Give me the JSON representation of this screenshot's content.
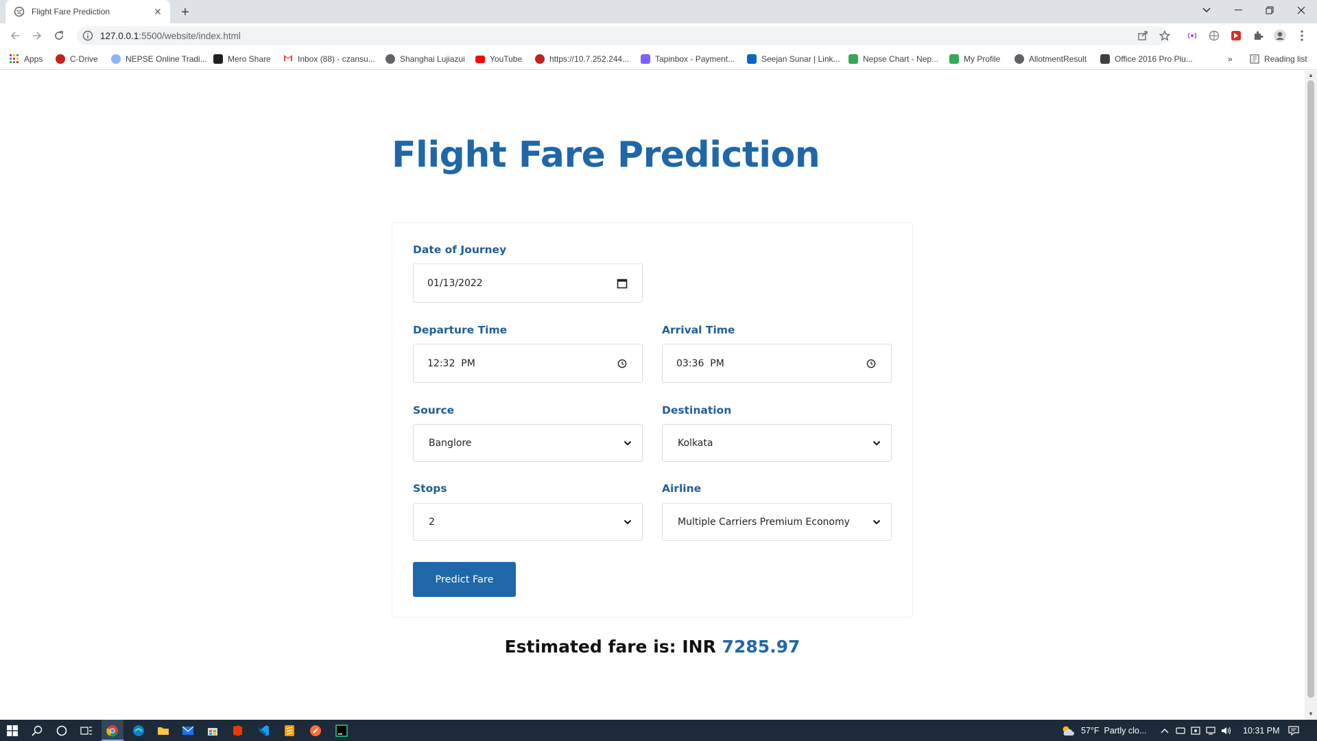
{
  "browser": {
    "tab_title": "Flight Fare Prediction",
    "url_host": "127.0.0.1",
    "url_path": ":5500/website/index.html",
    "bookmarks": [
      {
        "label": "Apps",
        "color": "#d93025"
      },
      {
        "label": "C-Drive",
        "color": "#c5221f"
      },
      {
        "label": "NEPSE Online Tradi...",
        "color": "#8ab4f8"
      },
      {
        "label": "Mero Share",
        "color": "#202124"
      },
      {
        "label": "Inbox (88) - czansu...",
        "color": "#ea4335"
      },
      {
        "label": "Shanghai Lujiazui",
        "color": "#5f6368"
      },
      {
        "label": "YouTube",
        "color": "#ff0000"
      },
      {
        "label": "https://10.7.252.244...",
        "color": "#c5221f"
      },
      {
        "label": "Tapinbox - Payment...",
        "color": "#7b61ff"
      },
      {
        "label": "Seejan Sunar | Link...",
        "color": "#0a66c2"
      },
      {
        "label": "Nepse Chart - Nep...",
        "color": "#34a853"
      },
      {
        "label": "My Profile",
        "color": "#34a853"
      },
      {
        "label": "AllotmentResult",
        "color": "#5f6368"
      },
      {
        "label": "Office 2016 Pro Plu...",
        "color": "#3c4043"
      }
    ],
    "reading_list": "Reading list"
  },
  "page": {
    "title": "Flight Fare Prediction",
    "form": {
      "date_label": "Date of Journey",
      "date_value": "01/13/2022",
      "departure_label": "Departure Time",
      "departure_value": "12:32  PM",
      "arrival_label": "Arrival Time",
      "arrival_value": "03:36  PM",
      "source_label": "Source",
      "source_value": "Banglore",
      "destination_label": "Destination",
      "destination_value": "Kolkata",
      "stops_label": "Stops",
      "stops_value": "2",
      "airline_label": "Airline",
      "airline_value": "Multiple Carriers Premium Economy",
      "submit_label": "Predict Fare"
    },
    "result_prefix": "Estimated fare is: INR ",
    "result_amount": "7285.97"
  },
  "taskbar": {
    "weather": "57°F  Partly clo...",
    "time": "10:31 PM"
  },
  "colors": {
    "brand": "#1f67a8",
    "label": "#1f5f9a"
  }
}
